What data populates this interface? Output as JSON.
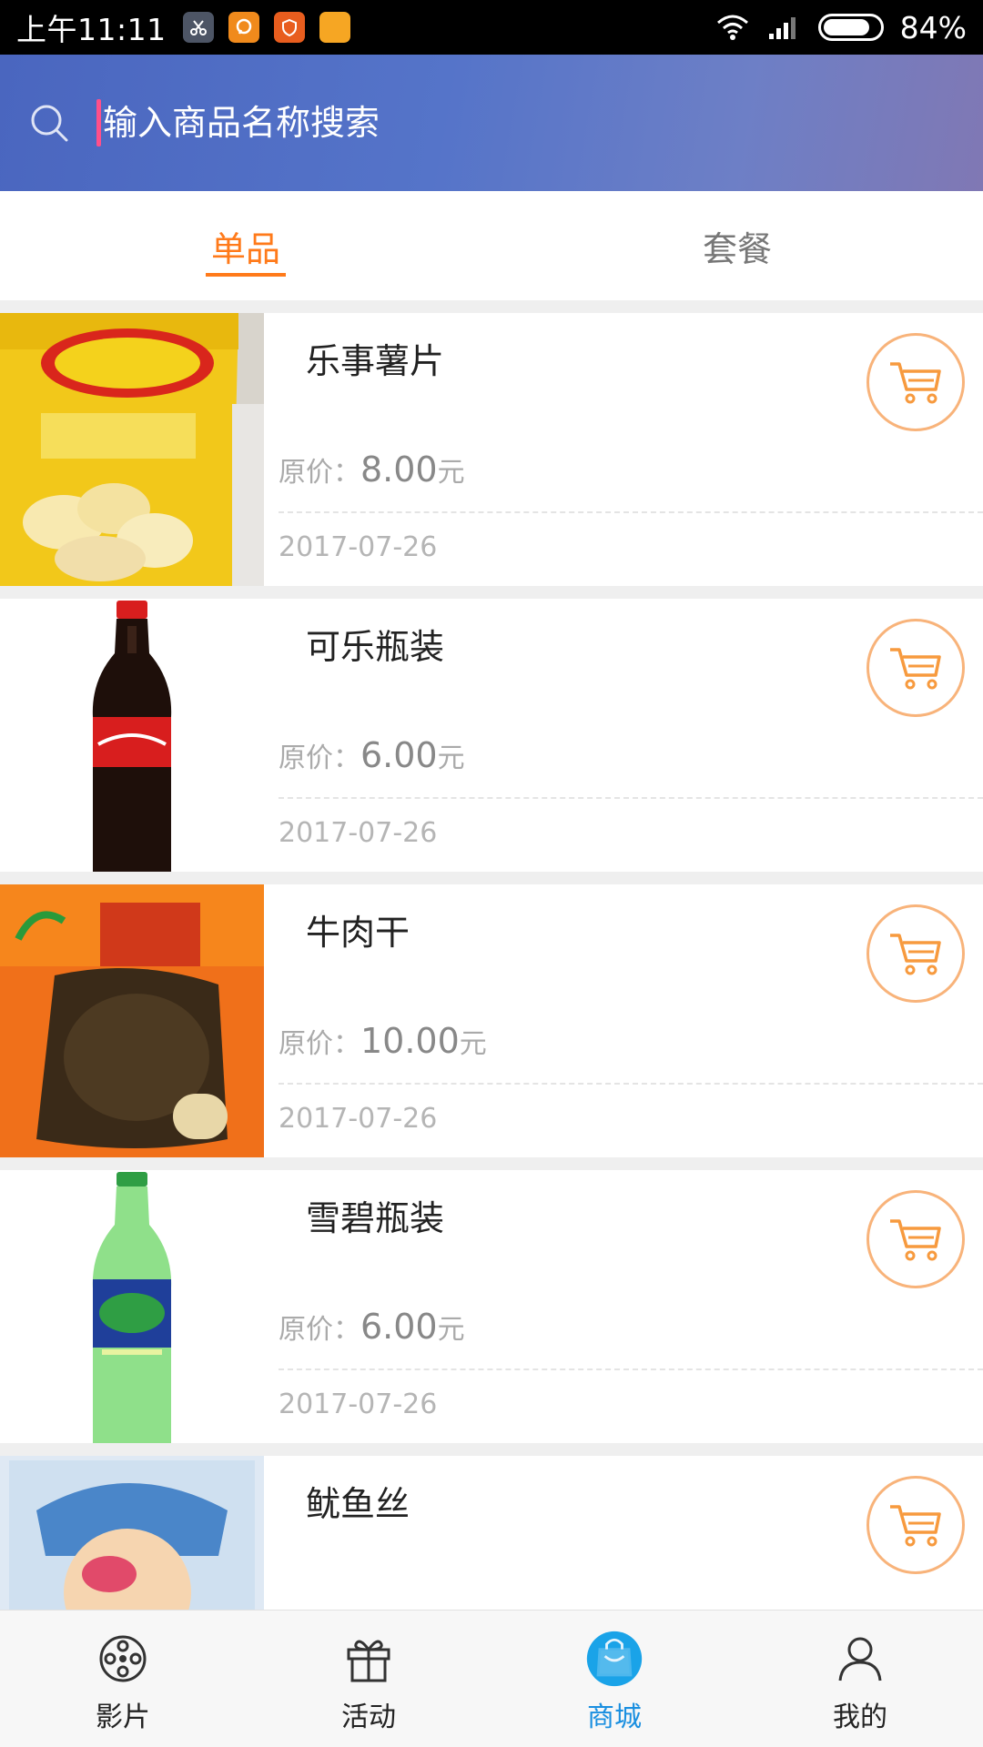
{
  "status_bar": {
    "time": "上午11:11",
    "battery": "84%",
    "battery_level": 0.84,
    "app_icons": [
      "cut-icon",
      "chat-icon",
      "shield-icon",
      "folder-icon"
    ]
  },
  "search": {
    "placeholder": "输入商品名称搜索"
  },
  "tabs": [
    {
      "label": "单品",
      "active": true
    },
    {
      "label": "套餐",
      "active": false
    }
  ],
  "products": [
    {
      "name": "乐事薯片",
      "price_label": "原价：",
      "price": "8.00",
      "unit": "元",
      "date": "2017-07-26",
      "image": "lays-chips-image"
    },
    {
      "name": "可乐瓶装",
      "price_label": "原价：",
      "price": "6.00",
      "unit": "元",
      "date": "2017-07-26",
      "image": "cola-bottle-image"
    },
    {
      "name": "牛肉干",
      "price_label": "原价：",
      "price": "10.00",
      "unit": "元",
      "date": "2017-07-26",
      "image": "beef-jerky-image"
    },
    {
      "name": "雪碧瓶装",
      "price_label": "原价：",
      "price": "6.00",
      "unit": "元",
      "date": "2017-07-26",
      "image": "sprite-bottle-image"
    },
    {
      "name": "鱿鱼丝",
      "image": "squid-shreds-image"
    }
  ],
  "bottom_nav": [
    {
      "label": "影片",
      "icon": "film-reel-icon",
      "active": false
    },
    {
      "label": "活动",
      "icon": "gift-icon",
      "active": false
    },
    {
      "label": "商城",
      "icon": "shopping-bag-icon",
      "active": true
    },
    {
      "label": "我的",
      "icon": "user-icon",
      "active": false
    }
  ],
  "colors": {
    "accent": "#ff7a1a",
    "nav_active": "#1a8fe0",
    "header_start": "#4a66bf",
    "header_end": "#8078b4",
    "cart_border": "#f8b37a"
  }
}
